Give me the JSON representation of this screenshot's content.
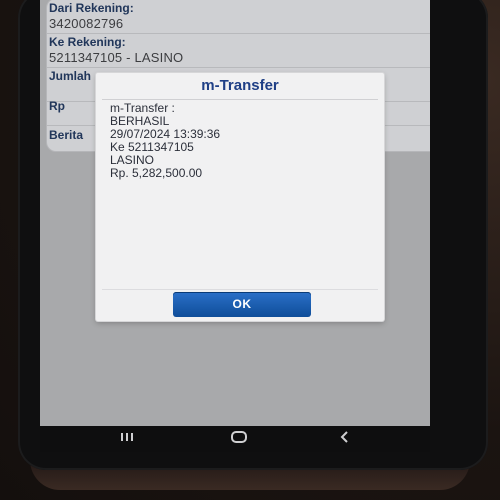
{
  "form": {
    "rows": [
      {
        "label": "Dari Rekening:",
        "value": "3420082796",
        "chevron": false
      },
      {
        "label": "Ke Rekening:",
        "value": "5211347105 - LASINO",
        "chevron": true
      },
      {
        "label": "Jumlah",
        "value": "",
        "chevron": false
      },
      {
        "label": "Rp",
        "value": "",
        "chevron": true
      },
      {
        "label": "Berita",
        "value": "",
        "chevron": true
      }
    ]
  },
  "dialog": {
    "title": "m-Transfer",
    "lines": [
      "m-Transfer :",
      "BERHASIL",
      "29/07/2024 13:39:36",
      "Ke 5211347105",
      "LASINO",
      "Rp. 5,282,500.00"
    ],
    "ok_label": "OK"
  },
  "navbar": {
    "recent_icon": "recent-apps-icon",
    "home_icon": "home-icon",
    "back_icon": "back-icon"
  },
  "colors": {
    "dialog_title": "#1f3f86",
    "ok_button": "#1a5fb4",
    "label": "#21365a",
    "chevron": "#1d5a9f"
  }
}
